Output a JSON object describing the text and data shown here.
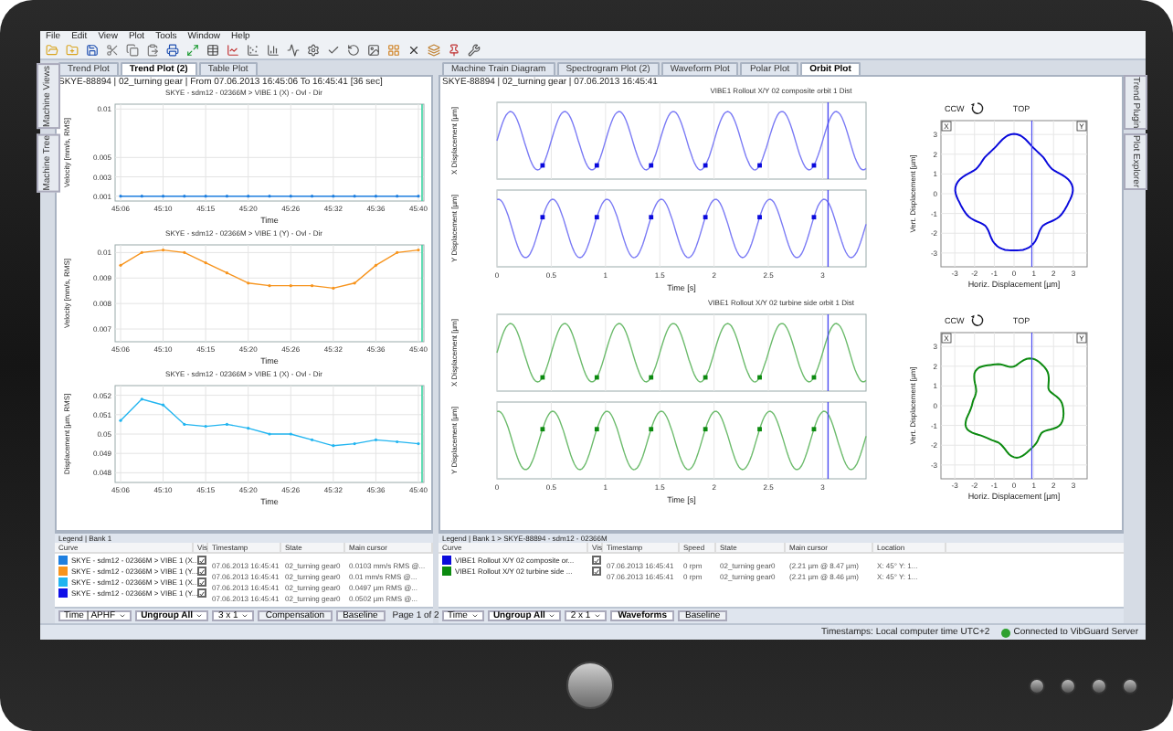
{
  "menu": [
    "File",
    "Edit",
    "View",
    "Plot",
    "Tools",
    "Window",
    "Help"
  ],
  "left_sidebar": [
    "Machine Views",
    "Machine Tree"
  ],
  "left_tabs": [
    {
      "label": "Trend Plot",
      "selected": false
    },
    {
      "label": "Trend Plot (2)",
      "selected": true
    },
    {
      "label": "Table Plot",
      "selected": false
    }
  ],
  "left_header": "SKYE-88894 | 02_turning gear | From 07.06.2013 16:45:06 To 16:45:41 [36 sec]",
  "trend_plots": [
    {
      "chart_data": {
        "type": "line",
        "title": "SKYE - sdm12 - 02366M > VIBE 1 (X) - Ovl - Dir",
        "xlabel": "Time",
        "ylabel": "Velocity [mm/s, RMS]",
        "ylim": [
          0.0005,
          0.0105
        ],
        "grid": true,
        "categories": [
          "45:06",
          null,
          "45:10",
          null,
          "45:15",
          null,
          "45:20",
          null,
          "45:26",
          null,
          "45:32",
          null,
          "45:36",
          null,
          "45:40"
        ],
        "yticks": [
          0.001,
          0.003,
          0.005,
          0.01
        ],
        "series": [
          {
            "color": "#1e7fe0",
            "values": [
              0.001,
              0.001,
              0.001,
              0.001,
              0.001,
              0.001,
              0.001,
              0.001,
              0.001,
              0.001,
              0.001,
              0.001,
              0.001,
              0.001,
              0.001
            ]
          }
        ]
      }
    },
    {
      "chart_data": {
        "type": "line",
        "title": "SKYE - sdm12 - 02366M > VIBE 1 (Y) - Ovl - Dir",
        "xlabel": "Time",
        "ylabel": "Velocity [mm/s, RMS]",
        "ylim": [
          0.0065,
          0.0103
        ],
        "grid": true,
        "categories": [
          "45:06",
          null,
          "45:10",
          null,
          "45:15",
          null,
          "45:20",
          null,
          "45:26",
          null,
          "45:32",
          null,
          "45:36",
          null,
          "45:40"
        ],
        "yticks": [
          0.007,
          0.008,
          0.009,
          0.01
        ],
        "series": [
          {
            "color": "#f7941d",
            "values": [
              0.0095,
              0.01,
              0.0101,
              0.01,
              0.0096,
              0.0092,
              0.0088,
              0.0087,
              0.0087,
              0.0087,
              0.0086,
              0.0088,
              0.0095,
              0.01,
              0.0101
            ]
          }
        ]
      }
    },
    {
      "chart_data": {
        "type": "line",
        "title": "SKYE - sdm12 - 02366M > VIBE 1 (X) - Ovl - Dir",
        "xlabel": "Time",
        "ylabel": "Displacement [µm, RMS]",
        "ylim": [
          0.0475,
          0.0525
        ],
        "grid": true,
        "categories": [
          "45:06",
          null,
          "45:10",
          null,
          "45:15",
          null,
          "45:20",
          null,
          "45:26",
          null,
          "45:32",
          null,
          "45:36",
          null,
          "45:40"
        ],
        "yticks": [
          0.048,
          0.049,
          0.05,
          0.051,
          0.052
        ],
        "series": [
          {
            "color": "#22b5f0",
            "values": [
              0.0507,
              0.0518,
              0.0515,
              0.0505,
              0.0504,
              0.0505,
              0.0503,
              0.05,
              0.05,
              0.0497,
              0.0494,
              0.0495,
              0.0497,
              0.0496,
              0.0495
            ]
          }
        ]
      }
    }
  ],
  "right_tabs": [
    {
      "label": "Machine Train Diagram",
      "selected": false
    },
    {
      "label": "Spectrogram Plot (2)",
      "selected": false
    },
    {
      "label": "Waveform Plot",
      "selected": false
    },
    {
      "label": "Polar Plot",
      "selected": false
    },
    {
      "label": "Orbit Plot",
      "selected": true
    }
  ],
  "right_header": "SKYE-88894 | 02_turning gear | 07.06.2013 16:45:41",
  "orbit_groups": [
    {
      "title": "VIBE1 Rollout X/Y 02 composite orbit 1 Dist",
      "x_ylabel": "X Displacement [µm]",
      "y_ylabel": "Y Displacement [µm]",
      "xticks": [
        "0",
        "0.5",
        "1",
        "1.5",
        "2",
        "2.5",
        "3"
      ],
      "xlabel": "Time [s]",
      "ccw": "CCW",
      "top": "TOP",
      "corner_left": "X",
      "corner_right": "Y",
      "orbit_ticks": [
        "3",
        "2",
        "1",
        "0",
        "-1",
        "-2",
        "-3"
      ],
      "orbit_xticks": [
        "-3",
        "-2",
        "-1",
        "0",
        "1",
        "2",
        "3"
      ],
      "orbit_xlabel": "Horiz. Displacement [µm]",
      "orbit_ylabel": "Vert. Displacement [µm]"
    },
    {
      "title": "VIBE1 Rollout X/Y 02 turbine side orbit 1 Dist",
      "x_ylabel": "X Displacement [µm]",
      "y_ylabel": "Y Displacement [µm]",
      "xticks": [
        "0",
        "0.5",
        "1",
        "1.5",
        "2",
        "2.5",
        "3"
      ],
      "xlabel": "Time [s]",
      "ccw": "CCW",
      "top": "TOP",
      "corner_left": "X",
      "corner_right": "Y",
      "orbit_ticks": [
        "3",
        "2",
        "1",
        "0",
        "-1",
        "-2",
        "-3"
      ],
      "orbit_xticks": [
        "-3",
        "-2",
        "-1",
        "0",
        "1",
        "2",
        "3"
      ],
      "orbit_xlabel": "Horiz. Displacement [µm]",
      "orbit_ylabel": "Vert. Displacement [µm]"
    }
  ],
  "right_sidebar": [
    "Trend Plugin",
    "Plot Explorer"
  ],
  "left_legend": {
    "title": "Legend | Bank 1",
    "columns": [
      "Curve",
      "Vis",
      "Timestamp",
      "State",
      "Main cursor"
    ],
    "rows": [
      {
        "curve": "SKYE - sdm12 - 02366M > VIBE 1 (X...",
        "color": "#1e7fe0",
        "visible": true,
        "timestamp": "07.06.2013 16:45:41",
        "state": "02_turning gear0",
        "main_cursor": "0.0103 mm/s RMS @..."
      },
      {
        "curve": "SKYE - sdm12 - 02366M > VIBE 1 (Y...",
        "color": "#f7941d",
        "visible": true,
        "timestamp": "07.06.2013 16:45:41",
        "state": "02_turning gear0",
        "main_cursor": "0.01 mm/s RMS @..."
      },
      {
        "curve": "SKYE - sdm12 - 02366M > VIBE 1 (X...",
        "color": "#22b5f0",
        "visible": true,
        "timestamp": "07.06.2013 16:45:41",
        "state": "02_turning gear0",
        "main_cursor": "0.0497 µm RMS @..."
      },
      {
        "curve": "SKYE - sdm12 - 02366M > VIBE 1 (Y...",
        "color": "#1010e8",
        "visible": true,
        "timestamp": "07.06.2013 16:45:41",
        "state": "02_turning gear0",
        "main_cursor": "0.0502 µm RMS @..."
      }
    ],
    "footer": {
      "x_axis": "Time | APHF",
      "group": "Ungroup All",
      "layout": "3 x 1",
      "buttons": [
        {
          "label": "Compensation",
          "selected": false
        },
        {
          "label": "Baseline",
          "selected": false
        }
      ],
      "page": "Page 1 of 2"
    }
  },
  "right_legend": {
    "title": "Legend | Bank 1 > SKYE-88894 - sdm12 - 02366M",
    "columns": [
      "Curve",
      "Vis",
      "Timestamp",
      "Speed",
      "State",
      "Main cursor",
      "Location"
    ],
    "rows": [
      {
        "curve": "VIBE1 Rollout X/Y 02 composite or...",
        "color": "#0a0adc",
        "visible": true,
        "timestamp": "07.06.2013 16:45:41",
        "speed": "0 rpm",
        "state": "02_turning gear0",
        "main_cursor": "(2.21 µm @ 8.47 µm)",
        "location": "X: 45° Y: 1..."
      },
      {
        "curve": "VIBE1 Rollout X/Y 02 turbine side ...",
        "color": "#0c8a10",
        "visible": true,
        "timestamp": "07.06.2013 16:45:41",
        "speed": "0 rpm",
        "state": "02_turning gear0",
        "main_cursor": "(2.21 µm @ 8.46 µm)",
        "location": "X: 45° Y: 1..."
      }
    ],
    "footer": {
      "x_axis": "Time",
      "group": "Ungroup All",
      "layout": "2 x 1",
      "buttons": [
        {
          "label": "Waveforms",
          "selected": true
        },
        {
          "label": "Baseline",
          "selected": false
        }
      ]
    }
  },
  "status_bar": {
    "timestamps": "Timestamps: Local computer time UTC+2",
    "connection": "Connected to VibGuard Server"
  }
}
